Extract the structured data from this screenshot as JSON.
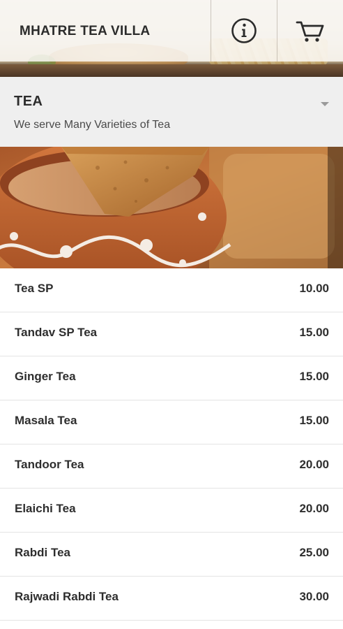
{
  "header": {
    "title": "MHATRE TEA VILLA",
    "info_icon": "info-icon",
    "cart_icon": "cart-icon"
  },
  "category": {
    "title": "TEA",
    "subtitle": "We serve Many Varieties of Tea",
    "expand_icon": "chevron-down-icon"
  },
  "menu": {
    "items": [
      {
        "name": "Tea SP",
        "price": "10.00"
      },
      {
        "name": "Tandav SP Tea",
        "price": "15.00"
      },
      {
        "name": "Ginger Tea",
        "price": "15.00"
      },
      {
        "name": "Masala Tea",
        "price": "15.00"
      },
      {
        "name": "Tandoor Tea",
        "price": "20.00"
      },
      {
        "name": "Elaichi Tea",
        "price": "20.00"
      },
      {
        "name": "Rabdi Tea",
        "price": "25.00"
      },
      {
        "name": "Rajwadi Rabdi Tea",
        "price": "30.00"
      }
    ]
  },
  "colors": {
    "header_text": "#2b2b2b",
    "category_bg": "#efefef",
    "divider": "#e4e4e4",
    "text": "#2e2e2e"
  }
}
